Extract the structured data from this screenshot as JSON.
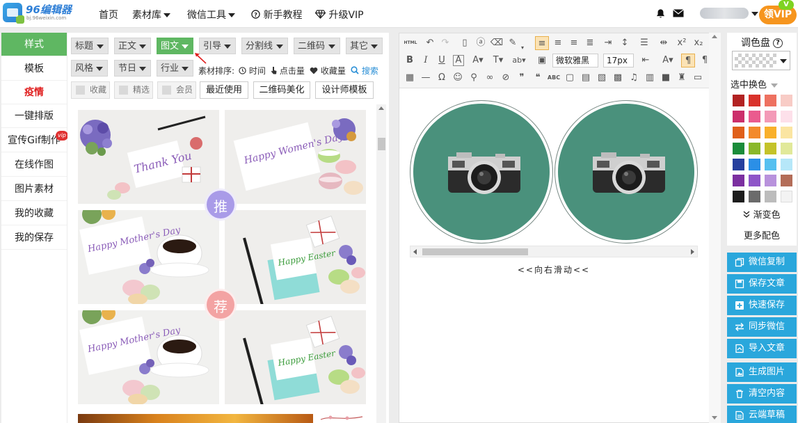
{
  "brand": {
    "name": "96编辑器",
    "url": "bj.96weixin.com"
  },
  "nav": {
    "home": "首页",
    "materials": "素材库",
    "wechat_tools": "微信工具",
    "tutorial": "新手教程",
    "upgrade": "升级VIP"
  },
  "vip": {
    "button": "领VIP",
    "badge": "V"
  },
  "sidebar": {
    "items": [
      {
        "label": "样式"
      },
      {
        "label": "模板"
      },
      {
        "label": "疫情"
      },
      {
        "label": "一键排版"
      },
      {
        "label": "宣传Gif制作",
        "badge": "vip"
      },
      {
        "label": "在线作图"
      },
      {
        "label": "图片素材"
      },
      {
        "label": "我的收藏"
      },
      {
        "label": "我的保存"
      }
    ]
  },
  "filters": {
    "row1": [
      "标题",
      "正文",
      "图文",
      "引导",
      "分割线",
      "二维码",
      "其它"
    ],
    "row2": [
      "风格",
      "节日",
      "行业"
    ],
    "active": "图文",
    "sort_label": "素材排序:",
    "sort_time": "时间",
    "sort_clicks": "点击量",
    "sort_favorites": "收藏量",
    "search": "搜索",
    "checks": [
      "收藏",
      "精选",
      "会员"
    ],
    "buttons": [
      "最近使用",
      "二维码美化",
      "设计师模板"
    ]
  },
  "gallery": {
    "cards": [
      {
        "text": "Thank You"
      },
      {
        "text": "Happy Women's Day"
      },
      {
        "text": "Happy Mother's Day"
      },
      {
        "text": "Happy Easter"
      },
      {
        "text": "Happy Mother's Day"
      },
      {
        "text": "Happy Easter"
      }
    ],
    "bubble_recommend": "推",
    "bubble_recommend2": "荐"
  },
  "editor": {
    "font_family": "微软雅黑",
    "font_size": "17px",
    "html_label": "HTML",
    "slide_hint": "<<向右滑动<<"
  },
  "palette": {
    "title": "调色盘",
    "pick_mode": "选中换色",
    "gradient": "渐变色",
    "more": "更多配色",
    "colors": [
      "#b22222",
      "#d9322b",
      "#ee7160",
      "#f8ccc6",
      "#cc2f6b",
      "#ea5b8e",
      "#f39ab7",
      "#fde0ea",
      "#e0601a",
      "#f38a2c",
      "#f9b02b",
      "#fbe5a2",
      "#1a8c3a",
      "#8ab82a",
      "#c4c32a",
      "#e1e99a",
      "#263f9e",
      "#2b8fe6",
      "#56c0f0",
      "#b6e7f9",
      "#7b2fa0",
      "#8e55c8",
      "#b892dc",
      "#b36d58",
      "#1c1c1c",
      "#6b6b6b",
      "#bcbcbc",
      "#f3f3f3"
    ]
  },
  "actions": [
    "微信复制",
    "保存文章",
    "快速保存",
    "同步微信",
    "导入文章",
    "生成图片",
    "清空内容",
    "云端草稿"
  ]
}
